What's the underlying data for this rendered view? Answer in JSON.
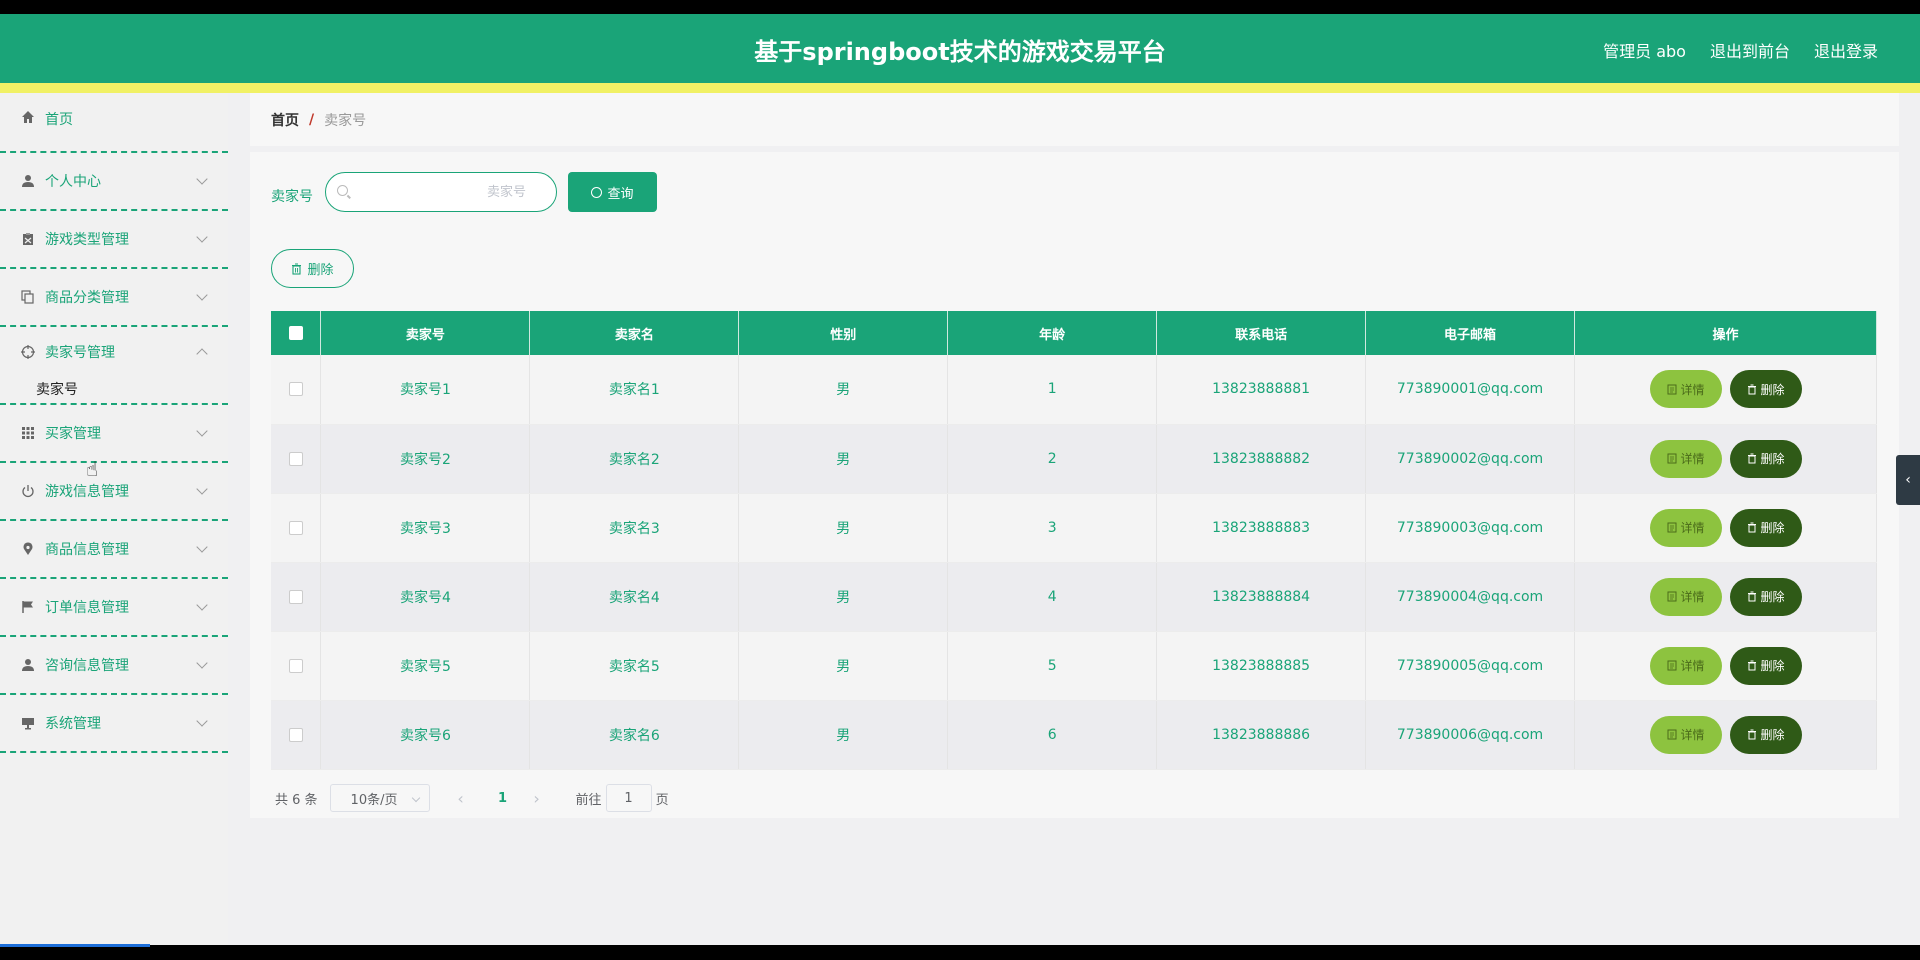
{
  "header": {
    "title": "基于springboot技术的游戏交易平台",
    "user_label": "管理员 abo",
    "to_front_label": "退出到前台",
    "logout_label": "退出登录"
  },
  "sidebar": {
    "items": [
      {
        "label": "首页",
        "icon": "home-icon"
      },
      {
        "label": "个人中心",
        "icon": "user-icon"
      },
      {
        "label": "游戏类型管理",
        "icon": "clipboard-icon"
      },
      {
        "label": "商品分类管理",
        "icon": "copy-icon"
      },
      {
        "label": "卖家号管理",
        "icon": "crosshair-icon"
      },
      {
        "label": "买家管理",
        "icon": "grid-icon"
      },
      {
        "label": "游戏信息管理",
        "icon": "power-icon"
      },
      {
        "label": "商品信息管理",
        "icon": "location-icon"
      },
      {
        "label": "订单信息管理",
        "icon": "flag-icon"
      },
      {
        "label": "咨询信息管理",
        "icon": "user-icon"
      },
      {
        "label": "系统管理",
        "icon": "monitor-icon"
      }
    ],
    "submenu_label": "卖家号"
  },
  "breadcrumb": {
    "home": "首页",
    "separator": "/",
    "current": "卖家号"
  },
  "search": {
    "label": "卖家号",
    "placeholder": "卖家号",
    "query_label": "查询",
    "delete_label": "删除"
  },
  "table": {
    "headers": [
      "卖家号",
      "卖家名",
      "性别",
      "年龄",
      "联系电话",
      "电子邮箱",
      "操作"
    ],
    "rows": [
      {
        "seller_no": "卖家号1",
        "seller_name": "卖家名1",
        "gender": "男",
        "age": "1",
        "phone": "13823888881",
        "email": "773890001@qq.com"
      },
      {
        "seller_no": "卖家号2",
        "seller_name": "卖家名2",
        "gender": "男",
        "age": "2",
        "phone": "13823888882",
        "email": "773890002@qq.com"
      },
      {
        "seller_no": "卖家号3",
        "seller_name": "卖家名3",
        "gender": "男",
        "age": "3",
        "phone": "13823888883",
        "email": "773890003@qq.com"
      },
      {
        "seller_no": "卖家号4",
        "seller_name": "卖家名4",
        "gender": "男",
        "age": "4",
        "phone": "13823888884",
        "email": "773890004@qq.com"
      },
      {
        "seller_no": "卖家号5",
        "seller_name": "卖家名5",
        "gender": "男",
        "age": "5",
        "phone": "13823888885",
        "email": "773890005@qq.com"
      },
      {
        "seller_no": "卖家号6",
        "seller_name": "卖家名6",
        "gender": "男",
        "age": "6",
        "phone": "13823888886",
        "email": "773890006@qq.com"
      }
    ],
    "detail_label": "详情",
    "delete_label": "删除"
  },
  "pagination": {
    "total_text": "共 6 条",
    "page_size": "10条/页",
    "current_page": "1",
    "goto_label": "前往",
    "goto_value": "1",
    "page_suffix": "页"
  },
  "colors": {
    "primary": "#1aa478",
    "accent_yellow": "#f1f165",
    "detail_button": "#8dc33f",
    "delete_button": "#2f5a17"
  }
}
